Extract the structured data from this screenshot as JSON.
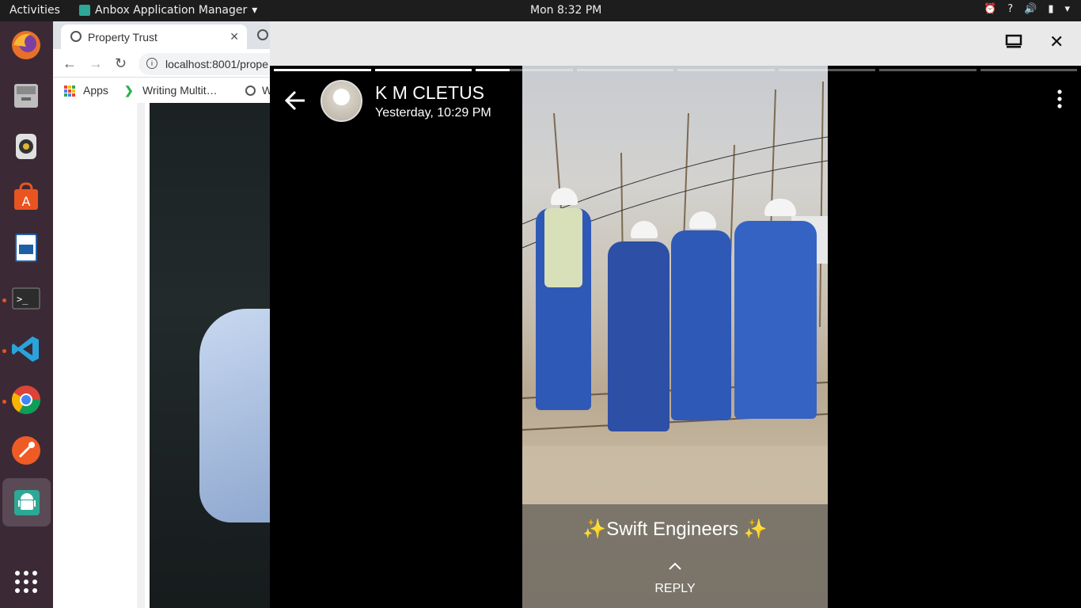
{
  "topbar": {
    "activities": "Activities",
    "app_menu": "Anbox Application Manager",
    "clock": "Mon  8:32 PM",
    "tray_help": "?"
  },
  "dock": {
    "items": [
      "firefox-icon",
      "files-icon",
      "rhythmbox-icon",
      "software-center-icon",
      "writer-icon",
      "terminal-icon",
      "vscode-icon",
      "chrome-icon",
      "postman-icon",
      "android-icon"
    ],
    "show_apps": "show-applications-icon"
  },
  "browser": {
    "tab_title": "Property Trust",
    "url": "localhost:8001/prope",
    "bookmark_apps": "Apps",
    "bookmark_writing": "Writing Multit…",
    "bookmark_w": "W"
  },
  "status": {
    "name": "K M CLETUS",
    "time": "Yesterday, 10:29 PM",
    "caption": "✨Swift Engineers ✨",
    "reply": "REPLY",
    "segments": [
      1,
      1,
      0.35,
      0,
      0,
      0,
      0,
      0
    ]
  }
}
